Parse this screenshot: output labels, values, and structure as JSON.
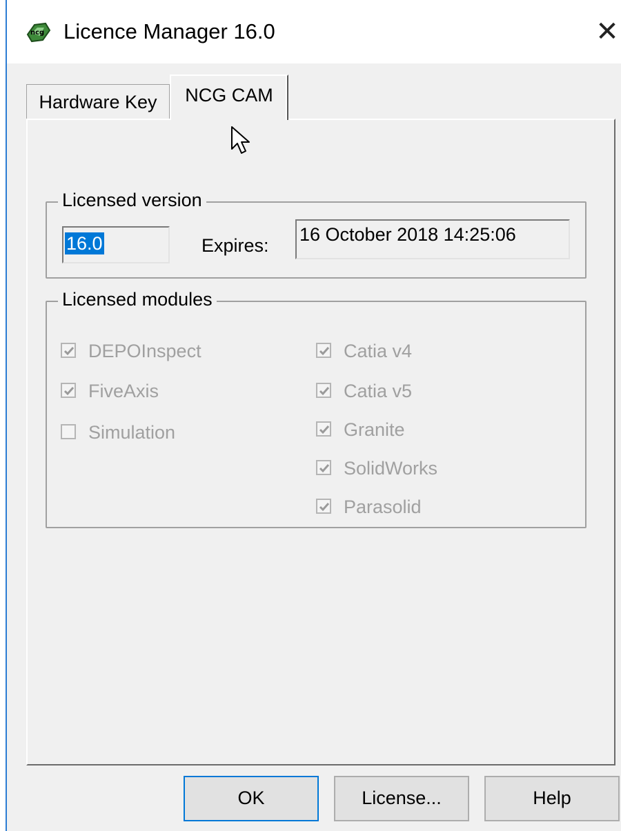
{
  "window": {
    "title": "Licence Manager 16.0",
    "close_glyph": "✕",
    "icon": "ncg-app-icon"
  },
  "tabs": [
    {
      "label": "Hardware Key",
      "active": false
    },
    {
      "label": "NCG CAM",
      "active": true
    }
  ],
  "licensed_version": {
    "label": "Licensed version",
    "value": "16.0",
    "expires_label": "Expires:",
    "expires_value": "16 October 2018 14:25:06"
  },
  "licensed_modules": {
    "label": "Licensed modules",
    "left": [
      {
        "label": "DEPOInspect",
        "checked": true
      },
      {
        "label": "FiveAxis",
        "checked": true
      },
      {
        "label": "Simulation",
        "checked": false
      }
    ],
    "right": [
      {
        "label": "Catia v4",
        "checked": true
      },
      {
        "label": "Catia v5",
        "checked": true
      },
      {
        "label": "Granite",
        "checked": true
      },
      {
        "label": "SolidWorks",
        "checked": true
      },
      {
        "label": "Parasolid",
        "checked": true
      }
    ]
  },
  "buttons": {
    "ok": "OK",
    "license": "License...",
    "help": "Help"
  },
  "colors": {
    "selection": "#0078d7",
    "dialog_bg": "#f0f0f0",
    "disabled_text": "#a0a0a0"
  }
}
